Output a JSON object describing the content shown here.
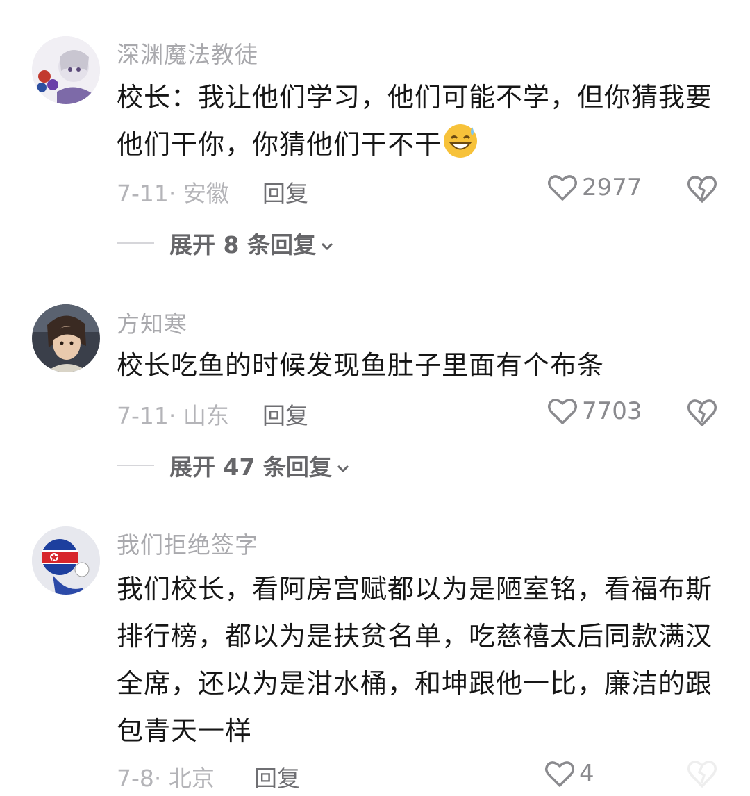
{
  "comments": [
    {
      "username": "深渊魔法教徒",
      "text": "校长：我让他们学习，他们可能不学，但你猜我要他们干你，你猜他们干不干",
      "emoji": "grinning-sweat-emoji",
      "date_location": "7-11· 安徽",
      "reply_label": "回复",
      "likes": "2977",
      "expand_label": "展开 8 条回复"
    },
    {
      "username": "方知寒",
      "text": "校长吃鱼的时候发现鱼肚子里面有个布条",
      "date_location": "7-11· 山东",
      "reply_label": "回复",
      "likes": "7703",
      "expand_label": "展开 47 条回复"
    },
    {
      "username": "我们拒绝签字",
      "text": "我们校长，看阿房宫赋都以为是陋室铭，看福布斯排行榜，都以为是扶贫名单，吃慈禧太后同款满汉全席，还以为是泔水桶，和坤跟他一比，廉洁的跟包青天一样",
      "date_location": "7-8· 北京",
      "reply_label": "回复",
      "likes": "4"
    }
  ],
  "icons": {
    "like": "heart-outline-icon",
    "dislike": "broken-heart-icon",
    "expand": "chevron-down-icon"
  },
  "colors": {
    "username": "#a9a9ad",
    "body_text": "#161616",
    "meta": "#b4b4b8",
    "expand_text": "#666669"
  }
}
